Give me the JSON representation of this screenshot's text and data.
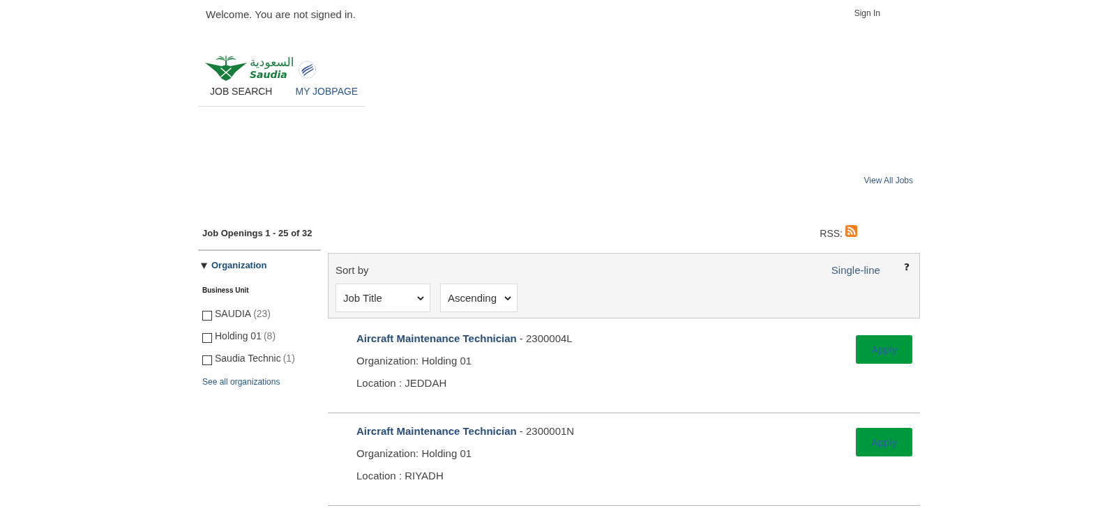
{
  "header": {
    "welcome": "Welcome. You are not signed in.",
    "sign_in": "Sign In"
  },
  "logo": {
    "arabic": "السعودية",
    "latin": "Saudia"
  },
  "nav": [
    {
      "label": "JOB SEARCH",
      "selected": true
    },
    {
      "label": "MY JOBPAGE",
      "selected": false
    }
  ],
  "view_all_jobs": "View All Jobs",
  "results": {
    "heading": "Job Openings 1 - 25 of 32",
    "rss_label": "RSS:"
  },
  "filters": [
    {
      "title": "Organization",
      "expanded": true,
      "group": "Business Unit",
      "options": [
        {
          "label": "SAUDIA",
          "count": "(23)",
          "checked": false
        },
        {
          "label": "Holding 01",
          "count": "(8)",
          "checked": false
        },
        {
          "label": "Saudia Technic",
          "count": "(1)",
          "checked": false
        }
      ],
      "see_all": "See all organizations"
    }
  ],
  "sort": {
    "label": "Sort by",
    "field": "Job Title",
    "order": "Ascending",
    "view_toggle": "Single-line",
    "help": "?"
  },
  "jobs": [
    {
      "title": "Aircraft Maintenance Technician",
      "reference": "- 2300004L",
      "organization": "Organization: Holding 01",
      "location": "Location : JEDDAH",
      "action": "Apply"
    },
    {
      "title": "Aircraft Maintenance Technician",
      "reference": "- 2300001N",
      "organization": "Organization: Holding 01",
      "location": "Location : RIYADH",
      "action": "Apply"
    }
  ]
}
